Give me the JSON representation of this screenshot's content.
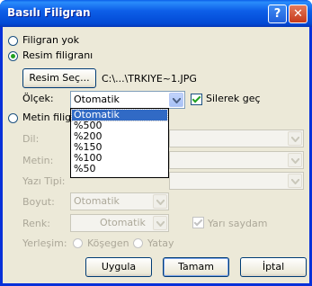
{
  "window": {
    "title": "Basılı Filigran",
    "help_icon": "?",
    "close_icon": "✕"
  },
  "options": {
    "no_watermark": "Filigran yok",
    "picture_watermark": "Resim filigranı",
    "text_watermark": "Metin filigra"
  },
  "picture": {
    "select_button": "Resim Seç...",
    "path": "C:\\...\\TRKIYE~1.JPG",
    "scale_label": "Ölçek:",
    "scale_value": "Otomatik",
    "washout_label": "Silerek geç",
    "scale_options": [
      "Otomatik",
      "%500",
      "%200",
      "%150",
      "%100",
      "%50"
    ]
  },
  "text": {
    "language_label": "Dil:",
    "text_label": "Metin:",
    "font_label": "Yazı Tipi:",
    "size_label": "Boyut:",
    "size_value": "Otomatik",
    "color_label": "Renk:",
    "color_value": "Otomatik",
    "semitransparent_label": "Yarı saydam",
    "layout_label": "Yerleşim:",
    "diagonal_label": "Köşegen",
    "horizontal_label": "Yatay"
  },
  "buttons": {
    "apply": "Uygula",
    "ok": "Tamam",
    "cancel": "İptal"
  }
}
